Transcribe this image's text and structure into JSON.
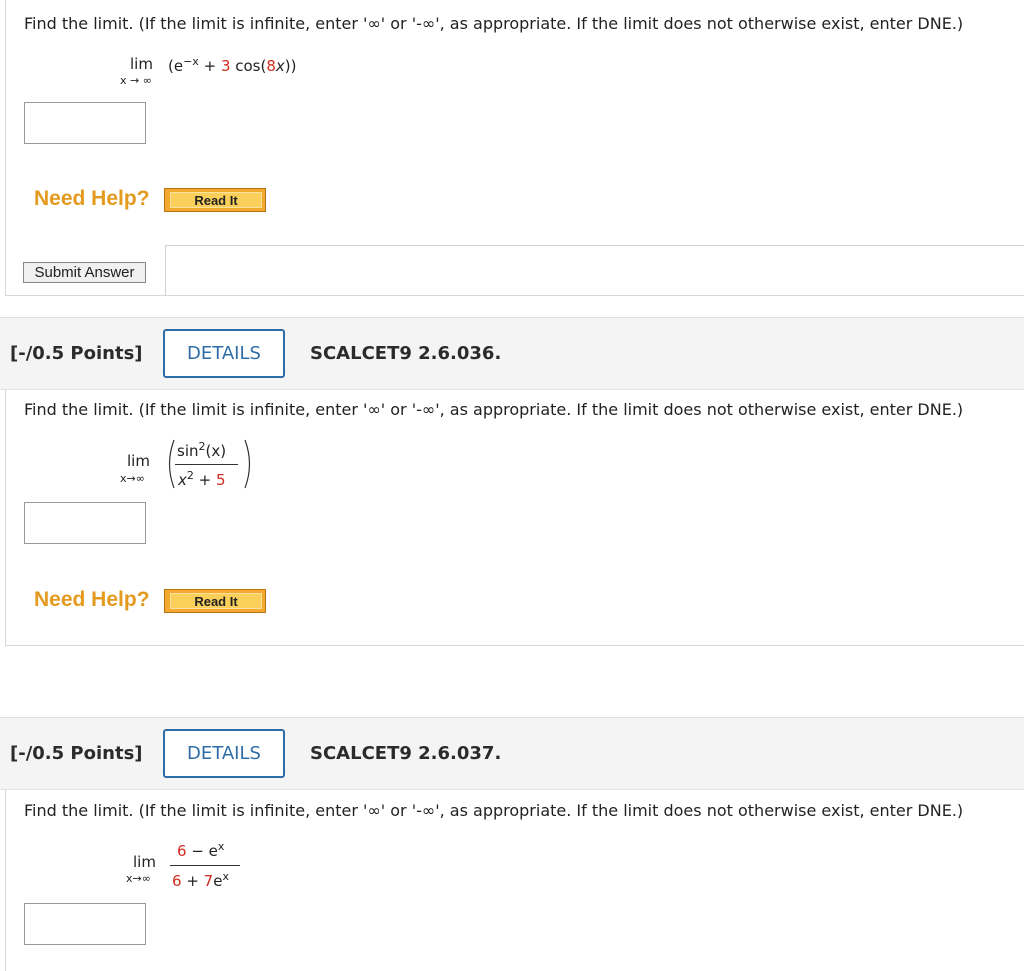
{
  "prompt": "Find the limit. (If the limit is infinite, enter '∞' or '-∞', as appropriate. If the limit does not otherwise exist, enter DNE.)",
  "need_help": "Need Help?",
  "read_it": "Read It",
  "submit": "Submit Answer",
  "q1": {
    "lim": "lim",
    "sub": "x → ∞",
    "expr_open": "(e",
    "expr_exp": "−x",
    "expr_plus": " + ",
    "coef": "3",
    "cos_open": " cos(",
    "cos_arg": "8",
    "cos_var": "x",
    "expr_close": "))"
  },
  "q2": {
    "points": "[-/0.5 Points]",
    "details": "DETAILS",
    "code": "SCALCET9 2.6.036.",
    "lim": "lim",
    "sub": "x→∞",
    "num_fn": "sin",
    "num_exp": "2",
    "num_arg": "(x)",
    "den_var": "x",
    "den_exp": "2",
    "den_plus": " + ",
    "den_const": "5"
  },
  "q3": {
    "points": "[-/0.5 Points]",
    "details": "DETAILS",
    "code": "SCALCET9 2.6.037.",
    "lim": "lim",
    "sub": "x→∞",
    "num_a": "6",
    "num_mid": " − e",
    "num_exp": "x",
    "den_a": "6",
    "den_mid": " + ",
    "den_b": "7",
    "den_e": "e",
    "den_exp": "x"
  }
}
